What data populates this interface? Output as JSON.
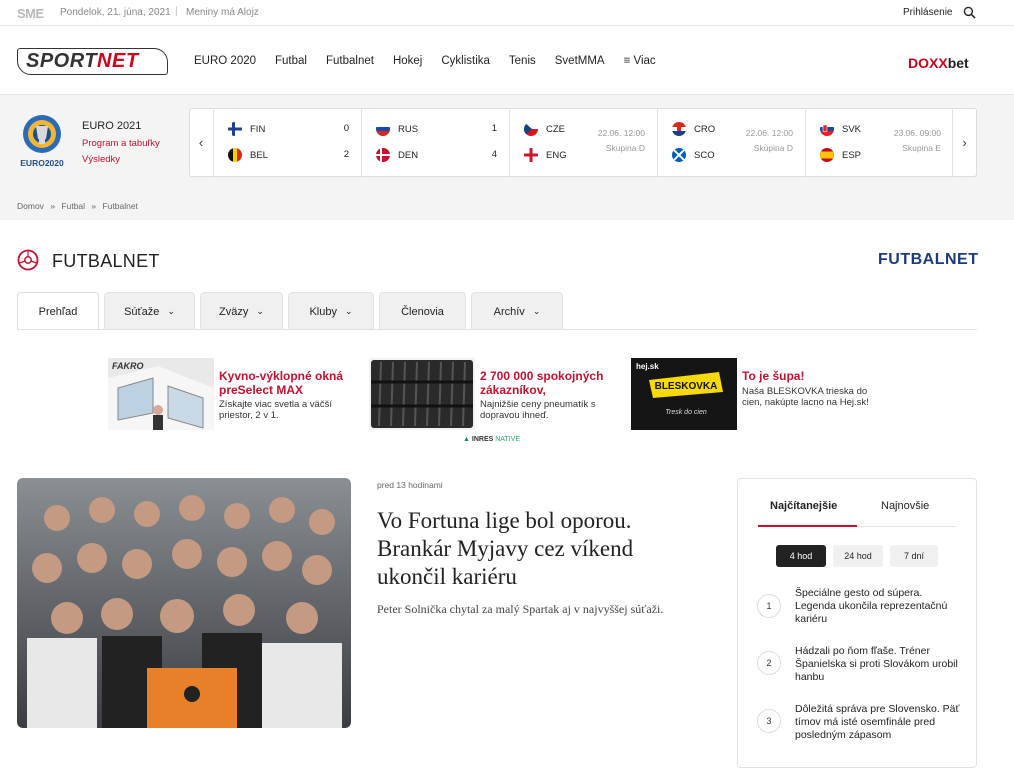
{
  "topbar": {
    "brand": "SME",
    "date": "Pondelok, 21. júna, 2021",
    "separator": "|",
    "nameday": "Meniny má Alojz",
    "login": "Prihlásenie"
  },
  "header": {
    "logo_a": "SPORT",
    "logo_b": "NET",
    "nav": [
      "EURO 2020",
      "Futbal",
      "Futbalnet",
      "Hokej",
      "Cyklistika",
      "Tenis",
      "SvetMMA",
      "≡  Viac"
    ],
    "sponsor_a": "DOXX",
    "sponsor_b": "bet"
  },
  "euro": {
    "logo_text": "EURO2020",
    "title": "EURO 2021",
    "links": [
      "Program a tabuľky",
      "Výsledky"
    ]
  },
  "matches": [
    {
      "t1": "FIN",
      "t2": "BEL",
      "s1": "0",
      "s2": "2",
      "f1": "fin",
      "f2": "bel"
    },
    {
      "t1": "RUS",
      "t2": "DEN",
      "s1": "1",
      "s2": "4",
      "f1": "rus",
      "f2": "den"
    },
    {
      "t1": "CZE",
      "t2": "ENG",
      "date": "22.06. 12:00",
      "group": "Skupina D",
      "f1": "cze",
      "f2": "eng"
    },
    {
      "t1": "CRO",
      "t2": "SCO",
      "date": "22.06. 12:00",
      "group": "Skupina D",
      "f1": "cro",
      "f2": "sco"
    },
    {
      "t1": "SVK",
      "t2": "ESP",
      "date": "23.06. 09:00",
      "group": "Skupina E",
      "f1": "svk",
      "f2": "esp"
    }
  ],
  "breadcrumb": {
    "items": [
      "Domov",
      "Futbal",
      "Futbalnet"
    ],
    "sep": "»"
  },
  "section": {
    "title": "FUTBALNET",
    "logo": "FUTBALNET"
  },
  "tabs": [
    {
      "label": "Prehľad",
      "dropdown": false
    },
    {
      "label": "Súťaže",
      "dropdown": true
    },
    {
      "label": "Zväzy",
      "dropdown": true
    },
    {
      "label": "Kluby",
      "dropdown": true
    },
    {
      "label": "Členovia",
      "dropdown": false
    },
    {
      "label": "Archív",
      "dropdown": true
    }
  ],
  "ads": [
    {
      "brand": "FAKRO",
      "title": "Kyvno-výklopné okná preSelect MAX",
      "text": "Získajte viac svetla a väčší priestor, 2 v 1."
    },
    {
      "brand": "",
      "title": "2 700 000 spokojných zákazníkov,",
      "text": "Najnižšie ceny pneumatík s dopravou ihneď."
    },
    {
      "brand": "hej.sk",
      "title": "To je šupa!",
      "text": "Naša BLESKOVKA trieska do cien, nakúpte lacno na Hej.sk!",
      "img_title": "BLESKOVKA",
      "img_sub": "Tresk do cien"
    }
  ],
  "ads_footer": {
    "a": "INRES",
    "b": "NATIVE"
  },
  "article": {
    "time": "pred 13 hodinami",
    "title": "Vo Fortuna lige bol oporou. Brankár Myjavy cez víkend ukončil kariéru",
    "subtitle": "Peter Solnička chytal za malý Spartak aj v najvyššej súťaži."
  },
  "sidebar": {
    "tabs": [
      "Najčítanejšie",
      "Najnovšie"
    ],
    "periods": [
      "4 hod",
      "24 hod",
      "7 dní"
    ],
    "items": [
      {
        "n": "1",
        "text": "Špeciálne gesto od súpera. Legenda ukončila reprezentačnú kariéru"
      },
      {
        "n": "2",
        "text": "Hádzali po ňom fľaše. Tréner Španielska si proti Slovákom urobil hanbu"
      },
      {
        "n": "3",
        "text": "Dôležitá správa pre Slovensko. Päť tímov má isté osemfinále pred posledným zápasom"
      }
    ]
  },
  "colors": {
    "accent": "#c8102e",
    "dark": "#222222",
    "strip": "#f4f4f4"
  }
}
